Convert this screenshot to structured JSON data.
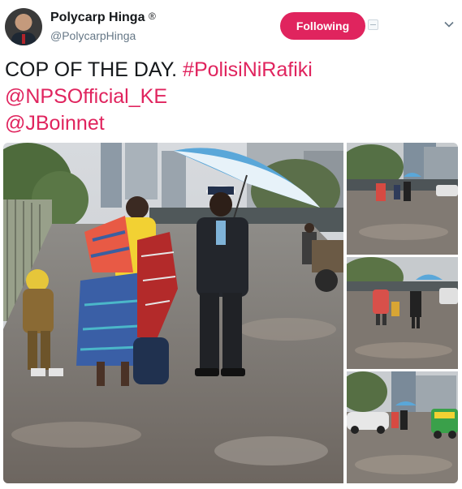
{
  "author": {
    "name": "Polycarp Hinga",
    "verified_mark": "®",
    "handle": "@PolycarpHinga"
  },
  "follow_button": {
    "label": "Following",
    "color": "#e0245e"
  },
  "icons": {
    "block": "block-icon",
    "more": "chevron-down-icon"
  },
  "tweet": {
    "text_prefix": "COP OF THE DAY. ",
    "hashtag": "#PolisiNiRafiki",
    "mention_1": "@NPSOfficial_KE",
    "mention_2": "@JBoinnet",
    "link_color": "#e0245e"
  },
  "media": {
    "photo_count": 4
  }
}
